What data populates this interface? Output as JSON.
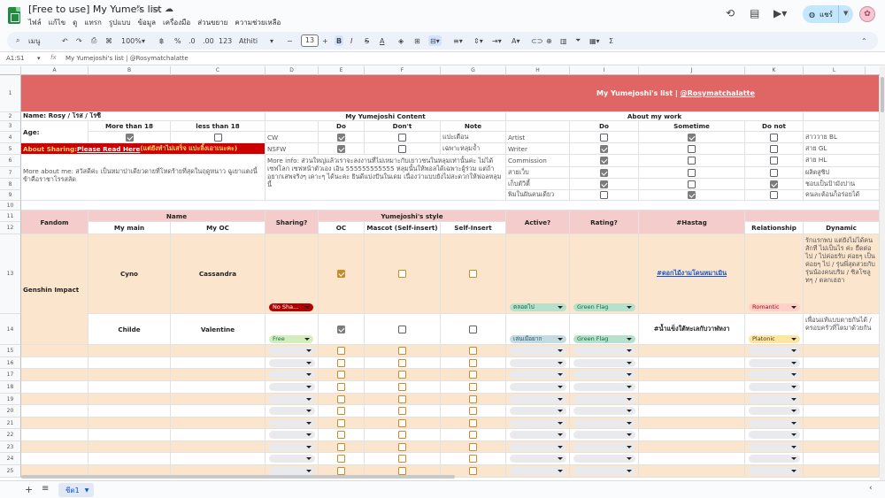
{
  "doc": {
    "title": "[Free to use] My Yume's list"
  },
  "menus": [
    "ไฟล์",
    "แก้ไข",
    "ดู",
    "แทรก",
    "รูปแบบ",
    "ข้อมูล",
    "เครื่องมือ",
    "ส่วนขยาย",
    "ความช่วยเหลือ"
  ],
  "toolbar": {
    "search": "เมนู",
    "zoom": "100%",
    "font": "Athiti",
    "font_size": "13",
    "decimals": ".0",
    "number_fmt": "123",
    "percent": "%",
    "currency": "฿",
    "sigma": "Σ"
  },
  "share": {
    "label": "แชร์"
  },
  "formula": {
    "cell": "A1:S1",
    "content": "My Yumejoshi's list | @Rosymatchalatte"
  },
  "columns": [
    "A",
    "B",
    "C",
    "D",
    "E",
    "F",
    "G",
    "H",
    "I",
    "J",
    "K",
    "L"
  ],
  "rows": [
    "1",
    "2",
    "3",
    "4",
    "5",
    "6",
    "7",
    "8",
    "9",
    "10",
    "11",
    "12",
    "13",
    "14",
    "15",
    "16",
    "17",
    "18",
    "19",
    "20",
    "21",
    "22",
    "23",
    "24",
    "25"
  ],
  "sheet": {
    "title_prefix": "My Yumejoshi's list | ",
    "title_handle": "@Rosymatchalatte",
    "name_label": "Name: Rosy / โรส / โรซี่",
    "age_label": "Age:",
    "more_than_18": "More than 18",
    "less_than_18": "less than 18",
    "content_header": "My Yumejoshi Content",
    "do": "Do",
    "dont": "Don't",
    "note": "Note",
    "about_work": "About my work",
    "sometime": "Sometime",
    "do_not": "Do not",
    "about_sharing_prefix": "About Sharing: ",
    "about_sharing_link": "Please Read Here",
    "about_sharing_suffix": " (แต่ยังทำไม่เสร็จ แปะลิ้งเอาเนะคะ)",
    "more_about_me": "More about me: สวัสดีค่ะ เป็นหมาป่าเดียวดายที่โหดร้ายที่สุดในฤดูหนาว ฉูเยาแตงนี้ข้าคือราชาโรรสลัด",
    "content_rows": [
      {
        "label": "CW",
        "note": "แปะเตือน"
      },
      {
        "label": "NSFW",
        "note": "เฉพาะหลุมจ้ำ"
      }
    ],
    "more_info": "More info: ส่วนใหญ่แล้วเราจะลงงานที่ไม่เหมาะกับเยาวชนในหลุมเท่านั้นค่ะ ไม่ได้เซฟโลก เซฟหน้าตัวเอง เอิน 555555555555 หลุมนั้นให้พอลได้เฉพาะผู้ร่วม แต่ถ้าอยากเสพจริงๆ เคาะๆ ได้นะคะ ยินดีแบ่งปันในเดม เนื่องว่าแบบยังไม่สะดวกให้ฟอลหลุมนี้",
    "work_rows": [
      "Artist",
      "Writer",
      "Commission",
      "สายเว็บ",
      "เก็บตัวิตี้",
      "พิมในฝันคนเดียว"
    ],
    "right_items": [
      "สาววาย BL",
      "สาย GL",
      "สาย HL",
      "ผลิตสูชิป",
      "ชอบเป็นป้ามังปาน",
      "คนละต้อนก็อร่อยได้"
    ],
    "fandom": "Fandom",
    "name_hdr": "Name",
    "my_main": "My main",
    "my_oc": "My OC",
    "sharing": "Sharing?",
    "style": "Yumejoshi's style",
    "oc": "OC",
    "mascot": "Mascot (Self-insert)",
    "self_insert": "Self-Insert",
    "active": "Active?",
    "rating": "Rating?",
    "hashtag": "#Hastag",
    "relationship": "Relationship",
    "dynamic": "Dynamic",
    "entries": [
      {
        "fandom": "Genshin Impact",
        "main": "Cyno",
        "oc": "Cassandra",
        "sharing": "No Sha...",
        "active": "ตลอดไป",
        "rating": "Green Flag",
        "hashtag": "#ดอกไม้งามโดนหมาเมิน",
        "relationship": "Romantic",
        "dynamic": "รักแรกพบ แต่ยังไม่ได้คนสักที ไม่เป็นไร ค่ะ ยืดต่อไป / ไปค่อยรับ ค่อยๆ เป็นค่อยๆ ไป / รุ่นพี่สุดสวยกับรุ่นน้องคนบริม / ซิลโซลูทๆ / ตลกเฮฮา"
      },
      {
        "fandom": "",
        "main": "Childe",
        "oc": "Valentine",
        "sharing": "Free",
        "active": "เล่นเมื่อยาก",
        "rating": "Green Flag",
        "hashtag": "#น้ำแข็งใต้ทะเลกับวาฬหงา",
        "relationship": "Platonic",
        "dynamic": "เพื่อนแท้แบบตายกันได้ / ครอบครัวที่โตมาด้วยกัน"
      }
    ]
  },
  "bottom": {
    "sheet_tab": "ชีต1"
  },
  "colors": {
    "title_bg": "#e06666",
    "header_bg": "#f4cccc",
    "row_bg": "#fce5cd",
    "share_bg": "#c2e7ff",
    "accent": "#0b57d0"
  }
}
